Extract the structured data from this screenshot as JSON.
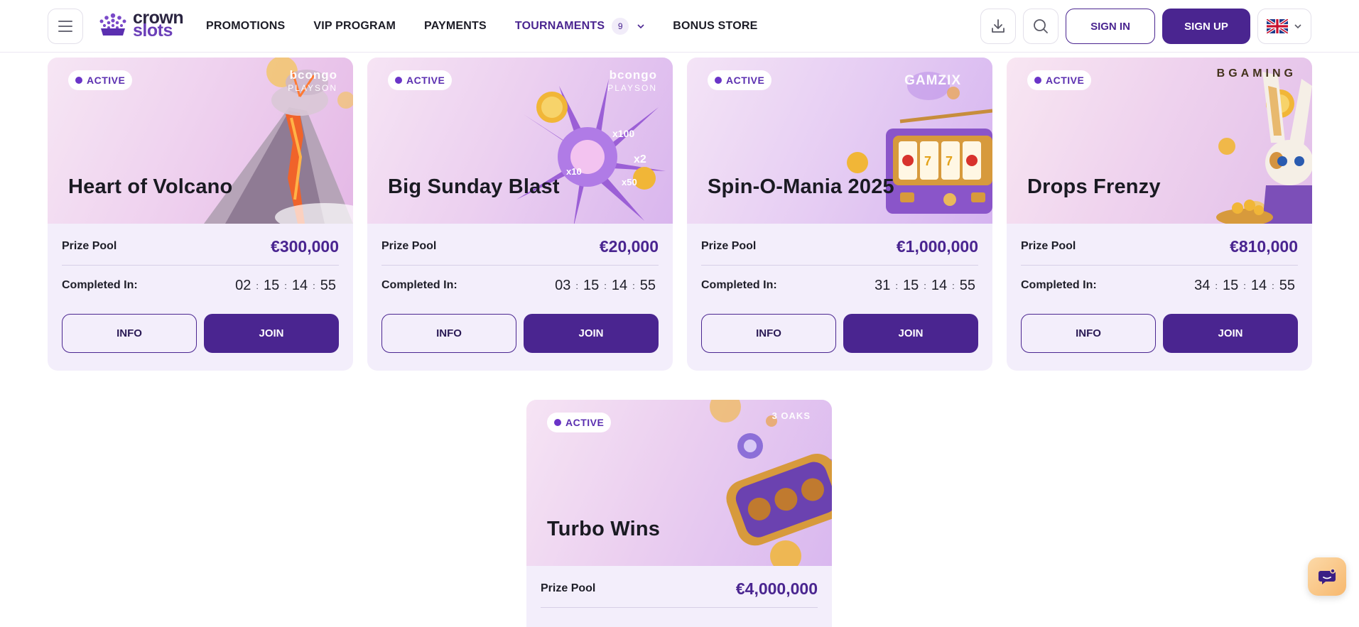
{
  "header": {
    "logo": {
      "line1": "crown",
      "line2": "slots"
    },
    "nav": [
      {
        "label": "PROMOTIONS"
      },
      {
        "label": "VIP PROGRAM"
      },
      {
        "label": "PAYMENTS"
      },
      {
        "label": "TOURNAMENTS",
        "count": "9"
      },
      {
        "label": "BONUS STORE"
      }
    ],
    "sign_in": "SIGN IN",
    "sign_up": "SIGN UP"
  },
  "common": {
    "prize_pool_label": "Prize Pool",
    "completed_label": "Completed In:",
    "info_label": "INFO",
    "join_label": "JOIN",
    "badge_label": "ACTIVE"
  },
  "tournaments": [
    {
      "title": "Heart of Volcano",
      "provider": "bcongo",
      "provider2": "PLAYSON",
      "prize": "€300,000",
      "timer": [
        "02",
        "15",
        "14",
        "55"
      ]
    },
    {
      "title": "Big Sunday Blast",
      "provider": "bcongo",
      "provider2": "PLAYSON",
      "prize": "€20,000",
      "timer": [
        "03",
        "15",
        "14",
        "55"
      ]
    },
    {
      "title": "Spin-O-Mania 2025",
      "provider": "GAMZIX",
      "prize": "€1,000,000",
      "timer": [
        "31",
        "15",
        "14",
        "55"
      ]
    },
    {
      "title": "Drops Frenzy",
      "provider": "BGAMING",
      "prize": "€810,000",
      "timer": [
        "34",
        "15",
        "14",
        "55"
      ]
    },
    {
      "title": "Turbo Wins",
      "provider": "3 OAKS",
      "prize": "€4,000,000"
    }
  ]
}
